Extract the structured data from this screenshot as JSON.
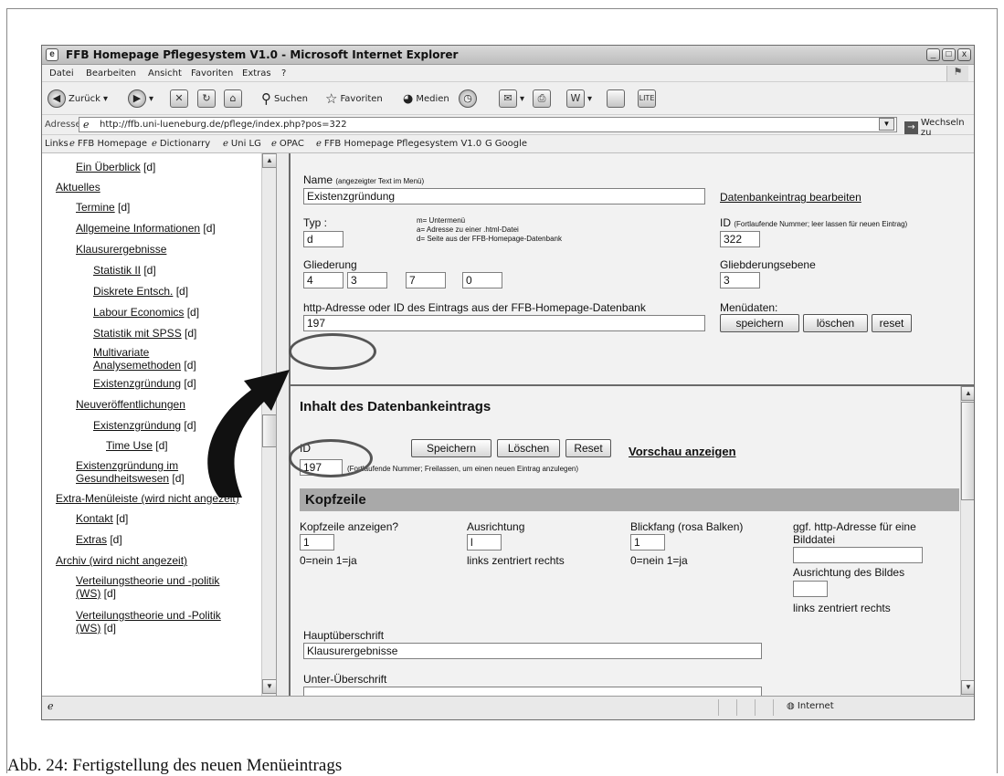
{
  "window": {
    "title": "FFB Homepage Pflegesystem V1.0 - Microsoft Internet Explorer",
    "controls": [
      "_",
      "□",
      "x"
    ]
  },
  "menu": [
    "Datei",
    "Bearbeiten",
    "Ansicht",
    "Favoriten",
    "Extras",
    "?"
  ],
  "toolbar": {
    "back": "Zurück",
    "search": "Suchen",
    "favorites": "Favoriten",
    "media": "Medien"
  },
  "address": {
    "label": "Adresse",
    "url": "http://ffb.uni-lueneburg.de/pflege/index.php?pos=322",
    "go": "Wechseln zu"
  },
  "links": {
    "label": "Links",
    "items": [
      "FFB Homepage",
      "Dictionarry",
      "Uni LG",
      "OPAC",
      "FFB Homepage Pflegesystem V1.0",
      "Google"
    ]
  },
  "nav": {
    "items": [
      {
        "label": "Ein Überblick",
        "suffix": " [d]"
      },
      {
        "label": "Aktuelles",
        "suffix": ""
      },
      {
        "label": "Termine",
        "suffix": " [d]"
      },
      {
        "label": "Allgemeine Informationen",
        "suffix": " [d]"
      },
      {
        "label": "Klausurergebnisse",
        "suffix": ""
      },
      {
        "label": "Statistik II",
        "suffix": " [d]"
      },
      {
        "label": "Diskrete Entsch.",
        "suffix": " [d]"
      },
      {
        "label": "Labour Economics",
        "suffix": " [d]"
      },
      {
        "label": "Statistik mit SPSS",
        "suffix": " [d]"
      },
      {
        "label": "Multivariate",
        "label2": "Analysemethoden",
        "suffix": " [d]"
      },
      {
        "label": "Existenzgründung",
        "suffix": " [d]"
      },
      {
        "label": "Neuveröffentlichungen",
        "suffix": ""
      },
      {
        "label": "Existenzgründung",
        "suffix": " [d]"
      },
      {
        "label": "Time Use",
        "suffix": " [d]"
      },
      {
        "label": "Existenzgründung im",
        "label2": "Gesundheitswesen",
        "suffix": " [d]"
      },
      {
        "label": "Extra-Menüleiste (wird nicht angezeit)",
        "suffix": ""
      },
      {
        "label": "Kontakt",
        "suffix": " [d]"
      },
      {
        "label": "Extras",
        "suffix": " [d]"
      },
      {
        "label": "Archiv (wird nicht angezeit)",
        "suffix": ""
      },
      {
        "label": "Verteilungstheorie und -politik",
        "label2": "(WS)",
        "suffix": " [d]"
      },
      {
        "label": "Verteilungstheorie und -Politik",
        "label2": "(WS)",
        "suffix": " [d]"
      }
    ]
  },
  "menu_form": {
    "name_label": "Name",
    "name_hint": "(angezeigter Text im Menü)",
    "name_value": "Existenzgründung",
    "db_edit_link": "Datenbankeintrag bearbeiten",
    "typ_label": "Typ :",
    "typ_value": "d",
    "typ_help": [
      "m= Untermenü",
      "a= Adresse zu einer .html-Datei",
      "d= Seite aus der FFB-Homepage-Datenbank"
    ],
    "id_label": "ID",
    "id_hint": "(Fortlaufende Nummer; leer lassen für neuen Eintrag)",
    "id_value": "322",
    "gliederung_label": "Gliederung",
    "gliederung_values": [
      "4",
      "3",
      "7",
      "0"
    ],
    "ebene_label": "Gliebderungsebene",
    "ebene_value": "3",
    "http_label": "http-Adresse oder ID des Eintrags aus der FFB-Homepage-Datenbank",
    "http_value": "197",
    "menudaten_label": "Menüdaten:",
    "buttons": [
      "speichern",
      "löschen",
      "reset"
    ]
  },
  "content_form": {
    "heading": "Inhalt des Datenbankeintrags",
    "id_label": "ID",
    "buttons": [
      "Speichern",
      "Löschen",
      "Reset"
    ],
    "preview_link": "Vorschau anzeigen",
    "id_value": "197",
    "id_hint": "(Fortlaufende Nummer; Freilassen, um einen neuen Eintrag anzulegen)",
    "section_title": "Kopfzeile",
    "kopf_label": "Kopfzeile anzeigen?",
    "kopf_value": "1",
    "kopf_help": "0=nein  1=ja",
    "ausrichtung_label": "Ausrichtung",
    "ausrichtung_value": "l",
    "ausrichtung_help": "links  zentriert  rechts",
    "blickfang_label": "Blickfang (rosa Balken)",
    "blickfang_value": "1",
    "blickfang_help": "0=nein  1=ja",
    "bild_label": "ggf. http-Adresse für eine",
    "bild_label2": "Bilddatei",
    "bild_value": "",
    "bildausr_label": "Ausrichtung des Bildes",
    "bildausr_value": "",
    "bildausr_help": "links  zentriert  rechts",
    "haupt_label": "Hauptüberschrift",
    "haupt_value": "Klausurergebnisse",
    "unter_label": "Unter-Überschrift",
    "unter_value": ""
  },
  "status": {
    "zone": "Internet"
  },
  "caption": "Abb. 24: Fertigstellung des neuen Menüeintrags"
}
